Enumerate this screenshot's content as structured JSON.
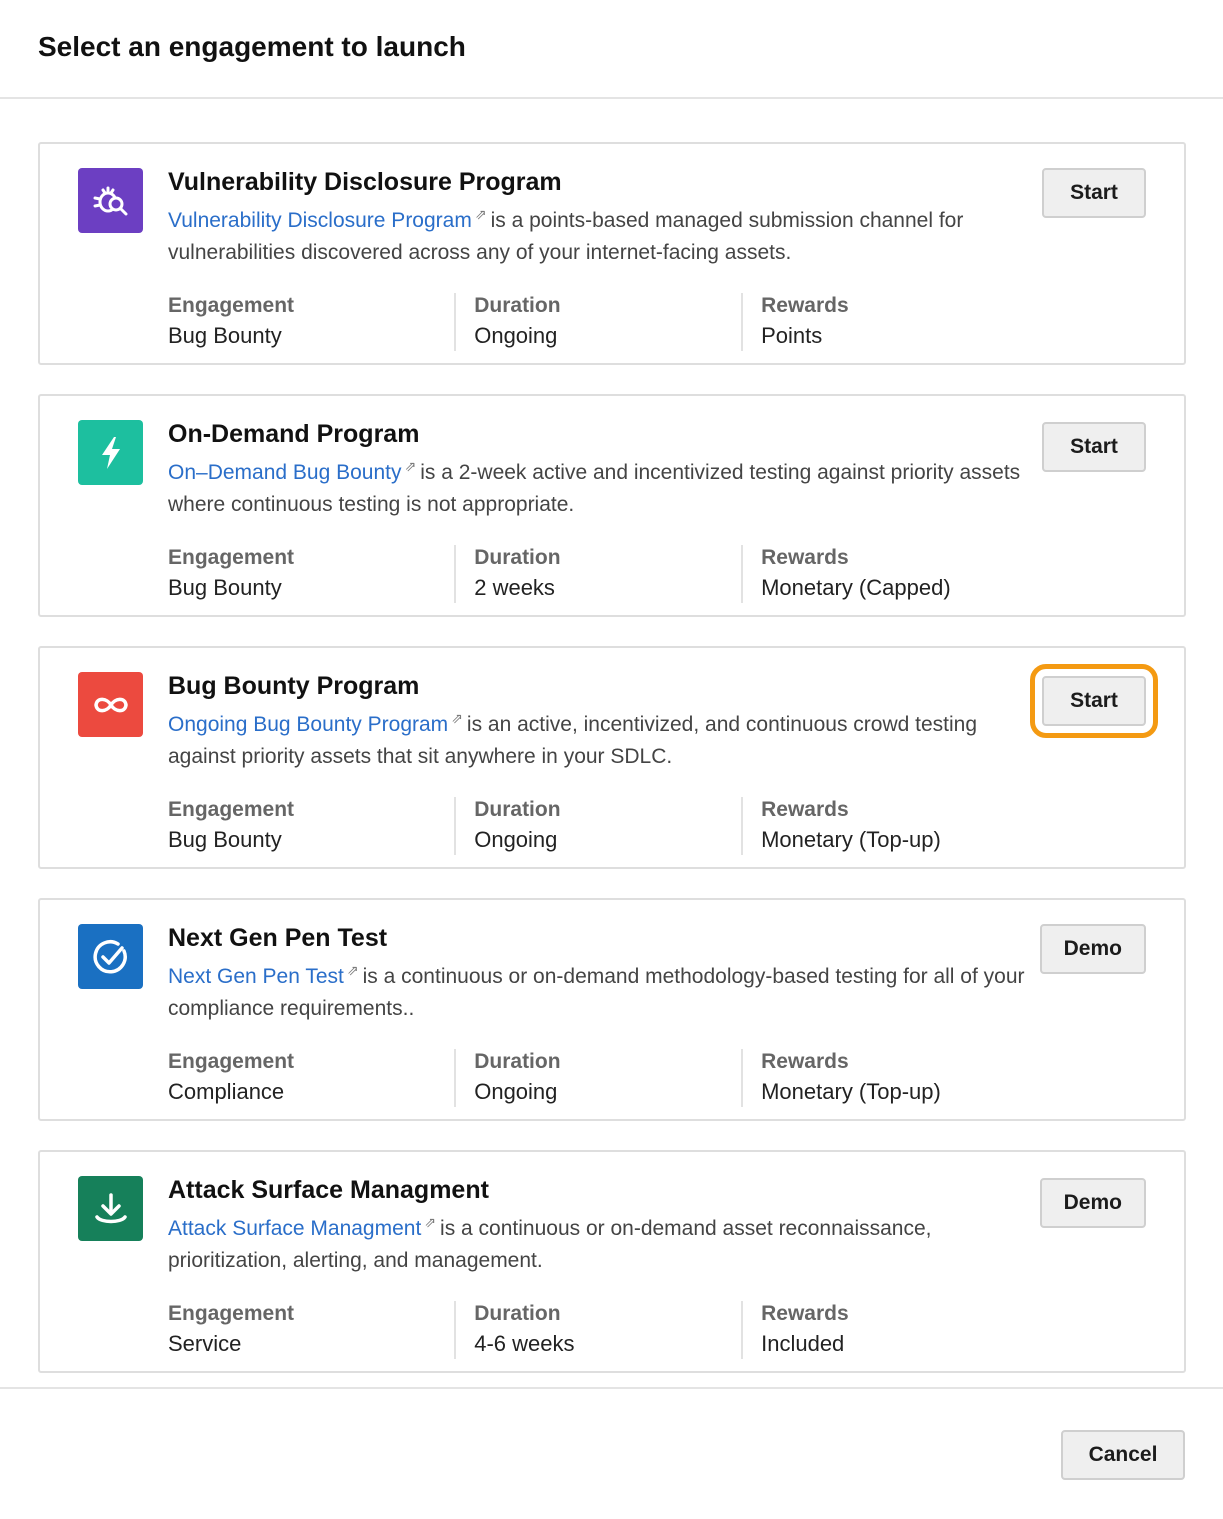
{
  "dialog": {
    "title": "Select an engagement to launch",
    "cancel_label": "Cancel",
    "highlight_color": "#f49a12"
  },
  "cards": [
    {
      "icon": "bug-search-icon",
      "icon_color": "#6c3fc2",
      "title": "Vulnerability Disclosure Program",
      "link_text": "Vulnerability Disclosure Program",
      "description": "is a points-based managed submission channel for vulnerabilities discovered across any of your internet-facing assets.",
      "button_label": "Start",
      "stats": [
        {
          "label": "Engagement",
          "value": "Bug Bounty"
        },
        {
          "label": "Duration",
          "value": "Ongoing"
        },
        {
          "label": "Rewards",
          "value": "Points"
        }
      ]
    },
    {
      "icon": "lightning-bolt-icon",
      "icon_color": "#1dbf9f",
      "title": "On-Demand Program",
      "link_text": "On–Demand Bug Bounty",
      "description": "is a 2-week active and incentivized testing against priority assets where continuous testing is not appropriate.",
      "button_label": "Start",
      "stats": [
        {
          "label": "Engagement",
          "value": "Bug Bounty"
        },
        {
          "label": "Duration",
          "value": "2 weeks"
        },
        {
          "label": "Rewards",
          "value": "Monetary (Capped)"
        }
      ]
    },
    {
      "icon": "infinity-icon",
      "icon_color": "#ec4a3f",
      "title": "Bug Bounty Program",
      "link_text": "Ongoing Bug Bounty Program",
      "description": "is an active, incentivized, and continuous crowd testing against priority assets that sit anywhere in your SDLC.",
      "button_label": "Start",
      "highlighted": true,
      "stats": [
        {
          "label": "Engagement",
          "value": "Bug Bounty"
        },
        {
          "label": "Duration",
          "value": "Ongoing"
        },
        {
          "label": "Rewards",
          "value": "Monetary (Top-up)"
        }
      ]
    },
    {
      "icon": "check-circle-icon",
      "icon_color": "#1a70c2",
      "title": "Next Gen Pen Test",
      "link_text": "Next Gen Pen Test",
      "description": "is a continuous or on-demand methodology-based testing for all of your compliance requirements..",
      "button_label": "Demo",
      "stats": [
        {
          "label": "Engagement",
          "value": "Compliance"
        },
        {
          "label": "Duration",
          "value": "Ongoing"
        },
        {
          "label": "Rewards",
          "value": "Monetary (Top-up)"
        }
      ]
    },
    {
      "icon": "download-icon",
      "icon_color": "#16805a",
      "title": "Attack Surface Managment",
      "link_text": "Attack Surface Managment",
      "description": "is a continuous or on-demand asset reconnaissance, prioritization, alerting, and management.",
      "button_label": "Demo",
      "stats": [
        {
          "label": "Engagement",
          "value": "Service"
        },
        {
          "label": "Duration",
          "value": "4-6 weeks"
        },
        {
          "label": "Rewards",
          "value": "Included"
        }
      ]
    }
  ]
}
